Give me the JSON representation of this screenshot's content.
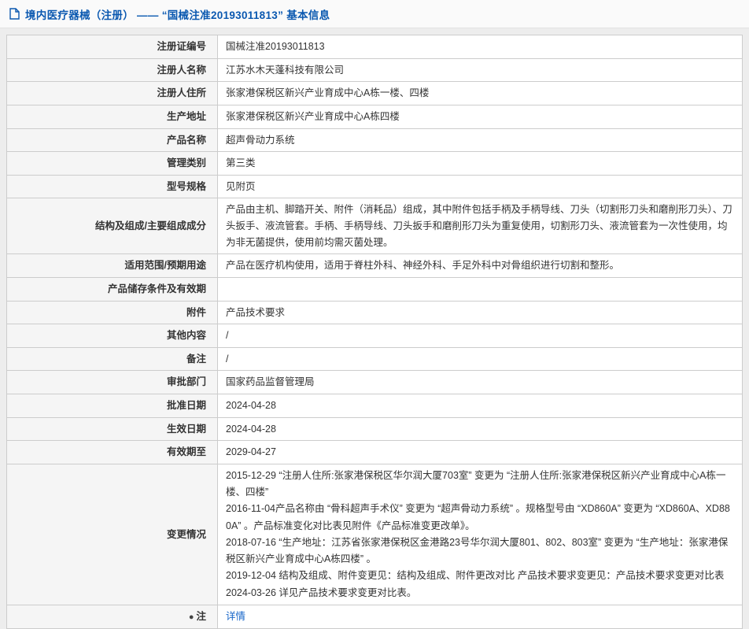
{
  "header": {
    "title": "境内医疗器械（注册） —— “国械注准20193011813” 基本信息",
    "accent_color": "#0a58b0"
  },
  "icons": {
    "note": "●",
    "document": "document-icon"
  },
  "table": {
    "label_bg": "#f5f5f5",
    "border_color": "#cccccc",
    "rows": [
      {
        "label": "注册证编号",
        "value": "国械注准20193011813"
      },
      {
        "label": "注册人名称",
        "value": "江苏水木天蓬科技有限公司"
      },
      {
        "label": "注册人住所",
        "value": "张家港保税区新兴产业育成中心A栋一楼、四楼"
      },
      {
        "label": "生产地址",
        "value": "张家港保税区新兴产业育成中心A栋四楼"
      },
      {
        "label": "产品名称",
        "value": "超声骨动力系统"
      },
      {
        "label": "管理类别",
        "value": "第三类"
      },
      {
        "label": "型号规格",
        "value": "见附页"
      },
      {
        "label": "结构及组成/主要组成成分",
        "value": "产品由主机、脚踏开关、附件（消耗品）组成，其中附件包括手柄及手柄导线、刀头（切割形刀头和磨削形刀头）、刀头扳手、液流管套。手柄、手柄导线、刀头扳手和磨削形刀头为重复使用，切割形刀头、液流管套为一次性使用，均为非无菌提供，使用前均需灭菌处理。",
        "multiline": false
      },
      {
        "label": "适用范围/预期用途",
        "value": "产品在医疗机构使用，适用于脊柱外科、神经外科、手足外科中对骨组织进行切割和整形。"
      },
      {
        "label": "产品储存条件及有效期",
        "value": ""
      },
      {
        "label": "附件",
        "value": "产品技术要求"
      },
      {
        "label": "其他内容",
        "value": "/"
      },
      {
        "label": "备注",
        "value": "/"
      },
      {
        "label": "审批部门",
        "value": "国家药品监督管理局"
      },
      {
        "label": "批准日期",
        "value": "2024-04-28"
      },
      {
        "label": "生效日期",
        "value": "2024-04-28"
      },
      {
        "label": "有效期至",
        "value": "2029-04-27"
      },
      {
        "label": "变更情况",
        "value": "2015-12-29 “注册人住所:张家港保税区华尔润大厦703室” 变更为 “注册人住所:张家港保税区新兴产业育成中心A栋一楼、四楼”\n2016-11-04产品名称由 “骨科超声手术仪” 变更为 “超声骨动力系统” 。规格型号由 “XD860A” 变更为 “XD860A、XD880A” 。产品标准变化对比表见附件《产品标准变更改单》。\n2018-07-16 “生产地址：江苏省张家港保税区金港路23号华尔润大厦801、802、803室” 变更为 “生产地址：张家港保税区新兴产业育成中心A栋四楼” 。\n2019-12-04 结构及组成、附件变更见：结构及组成、附件更改对比 产品技术要求变更见：产品技术要求变更对比表\n2024-03-26 详见产品技术要求变更对比表。",
        "multiline": true
      },
      {
        "label": "注",
        "value": "详情",
        "link": true,
        "label_icon": true
      }
    ]
  }
}
